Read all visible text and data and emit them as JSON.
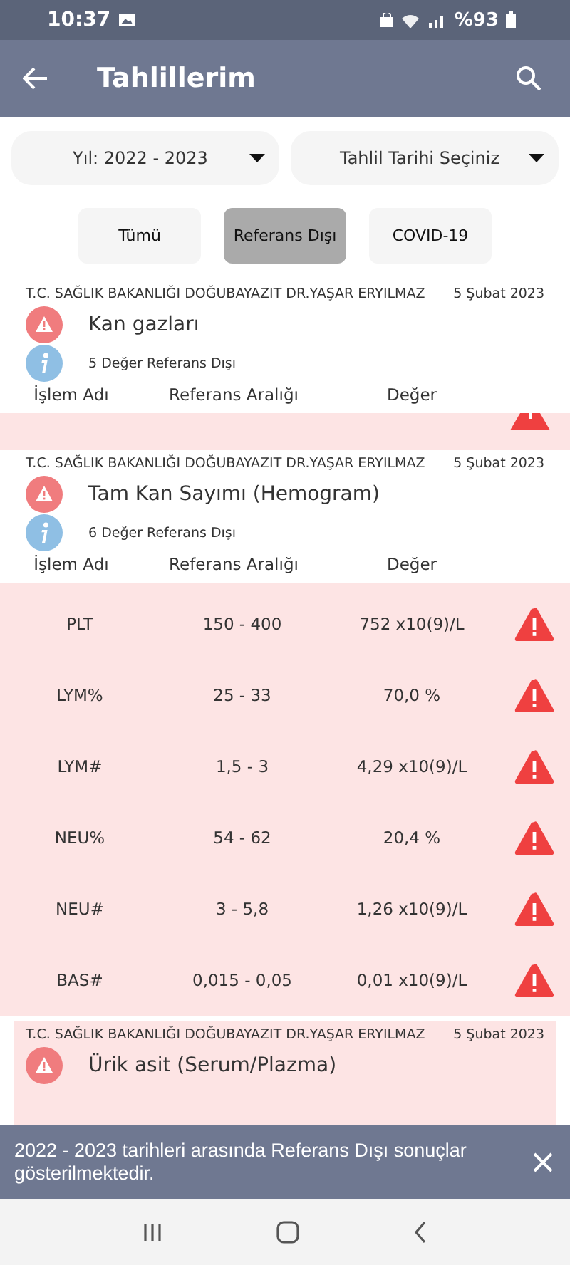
{
  "status_bar": {
    "time": "10:37",
    "battery": "%93"
  },
  "app_bar": {
    "title": "Tahlillerim"
  },
  "dropdowns": [
    {
      "label": "Yıl: 2022 - 2023"
    },
    {
      "label": "Tahlil Tarihi Seçiniz"
    }
  ],
  "filters": [
    {
      "label": "Tümü",
      "selected": false
    },
    {
      "label": "Referans Dışı",
      "selected": true
    },
    {
      "label": "COVID-19",
      "selected": false
    }
  ],
  "cards": [
    {
      "kind": "scrolled",
      "hospital": "T.C. SAĞLIK BAKANLIĞI DOĞUBAYAZIT DR.YAŞAR ERYILMAZ",
      "date": "5 Şubat 2023",
      "test": "Kan gazları",
      "info": "5 Değer Referans Dışı",
      "columns": [
        "İşlem Adı",
        "Referans Aralığı",
        "Değer"
      ]
    },
    {
      "kind": "open",
      "hospital": "T.C. SAĞLIK BAKANLIĞI DOĞUBAYAZIT DR.YAŞAR ERYILMAZ",
      "date": "5 Şubat 2023",
      "test": "Tam Kan Sayımı (Hemogram)",
      "info": "6 Değer Referans Dışı",
      "columns": [
        "İşlem Adı",
        "Referans Aralığı",
        "Değer"
      ],
      "rows": [
        {
          "name": "PLT",
          "range": "150 - 400",
          "value": "752 x10(9)/L"
        },
        {
          "name": "LYM%",
          "range": "25 - 33",
          "value": "70,0 %"
        },
        {
          "name": "LYM#",
          "range": "1,5 - 3",
          "value": "4,29 x10(9)/L"
        },
        {
          "name": "NEU%",
          "range": "54 - 62",
          "value": "20,4 %"
        },
        {
          "name": "NEU#",
          "range": "3 - 5,8",
          "value": "1,26 x10(9)/L"
        },
        {
          "name": "BAS#",
          "range": "0,015 - 0,05",
          "value": "0,01 x10(9)/L"
        }
      ]
    },
    {
      "kind": "closed",
      "hospital": "T.C. SAĞLIK BAKANLIĞI DOĞUBAYAZIT DR.YAŞAR ERYILMAZ",
      "date": "5 Şubat 2023",
      "test": "Ürik asit (Serum/Plazma)"
    }
  ],
  "snackbar": {
    "message": "2022 - 2023 tarihleri arasında Referans Dışı sonuçlar gösterilmektedir."
  }
}
